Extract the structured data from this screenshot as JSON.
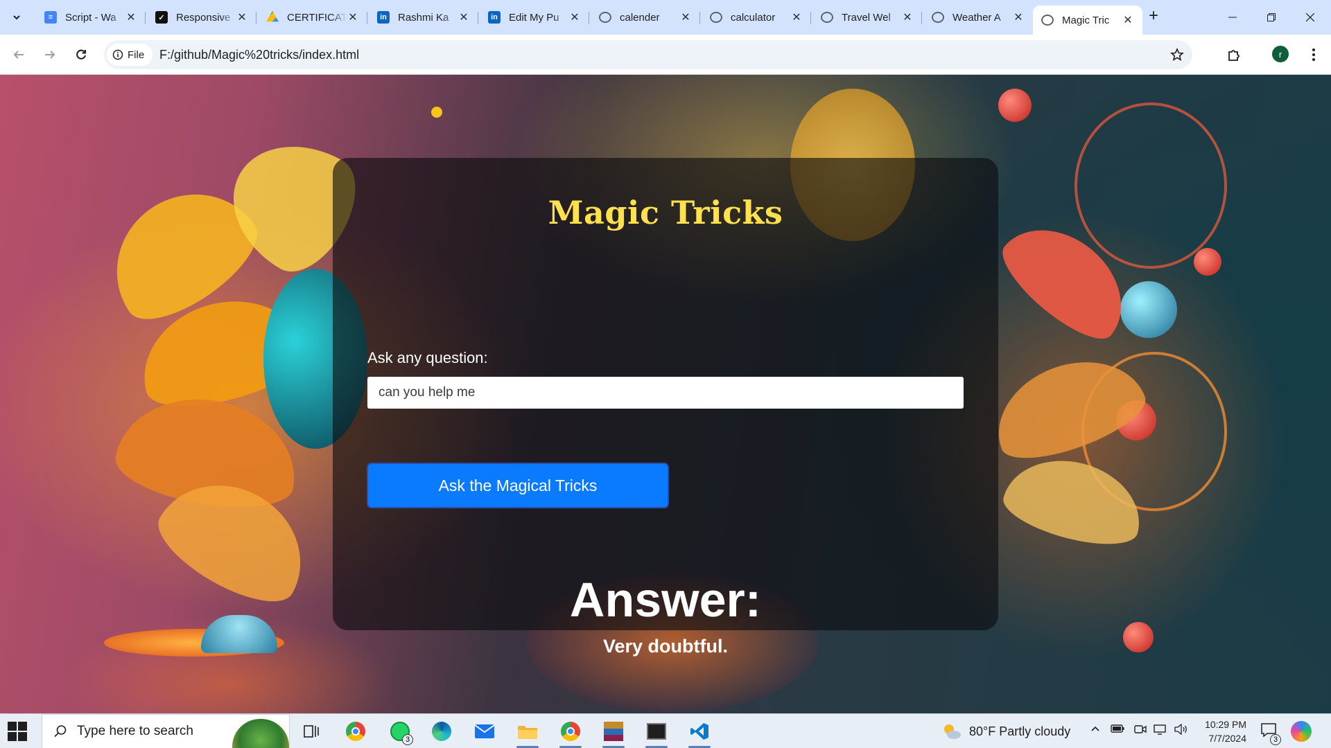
{
  "browser": {
    "tabs": [
      {
        "title": "Script - Wa",
        "icon": "google-docs-icon",
        "color": "#4285f4"
      },
      {
        "title": "Responsive",
        "icon": "checkbox-icon",
        "color": "#111111"
      },
      {
        "title": "CERTIFICAT",
        "icon": "google-drive-icon",
        "color": "#fbbc04"
      },
      {
        "title": "Rashmi Ka",
        "icon": "linkedin-icon",
        "color": "#0a66c2"
      },
      {
        "title": "Edit My Pu",
        "icon": "linkedin-icon",
        "color": "#0a66c2"
      },
      {
        "title": "calender",
        "icon": "globe-icon",
        "color": "#5f6368"
      },
      {
        "title": "calculator",
        "icon": "globe-icon",
        "color": "#5f6368"
      },
      {
        "title": "Travel Wel",
        "icon": "globe-icon",
        "color": "#5f6368"
      },
      {
        "title": "Weather A",
        "icon": "globe-icon",
        "color": "#5f6368"
      },
      {
        "title": "Magic Tric",
        "icon": "globe-icon",
        "color": "#5f6368",
        "active": true
      }
    ],
    "address": {
      "chip_label": "File",
      "url": "F:/github/Magic%20tricks/index.html"
    },
    "profile_initial": "r"
  },
  "page": {
    "title": "Magic Tricks",
    "question_label": "Ask any question:",
    "question_value": "can you help me",
    "ask_button": "Ask the Magical Tricks",
    "answer_heading": "Answer:",
    "answer_text": "Very doubtful."
  },
  "taskbar": {
    "search_placeholder": "Type here to search",
    "whatsapp_badge": "3",
    "weather": "80°F  Partly cloudy",
    "time": "10:29 PM",
    "date": "7/7/2024",
    "notification_count": "3"
  },
  "colors": {
    "title_yellow": "#ffe14d",
    "button_blue": "#0a7bff",
    "card_overlay": "rgba(12,12,14,0.62)"
  }
}
